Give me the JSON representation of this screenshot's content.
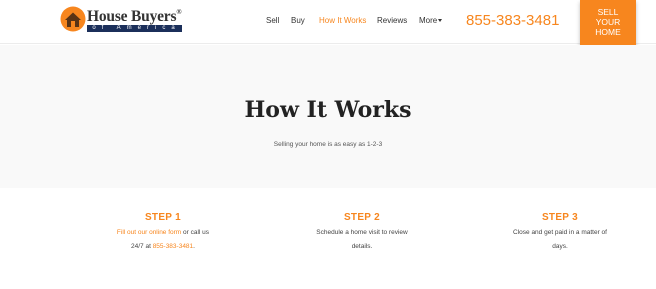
{
  "logo": {
    "title": "House Buyers",
    "reg": "®",
    "tagline": "of America"
  },
  "nav": {
    "items": [
      "Sell",
      "Buy",
      "How It Works",
      "Reviews",
      "More"
    ],
    "active_index": 2
  },
  "phone": "855-383-3481",
  "sell_button": {
    "line1": "SELL",
    "line2": "YOUR",
    "line3": "HOME"
  },
  "hero": {
    "title": "How It Works",
    "subtitle": "Selling your home is as easy as 1-2-3"
  },
  "steps": [
    {
      "title": "STEP 1",
      "link_text": "Fill out our online form",
      "text_a": " or call us",
      "text_b": "24/7 at ",
      "phone": "855-383-3481",
      "text_c": "."
    },
    {
      "title": "STEP 2",
      "line1": "Schedule a home visit to review",
      "line2": "details."
    },
    {
      "title": "STEP 3",
      "line1": "Close and get paid in a matter of",
      "line2": "days."
    }
  ],
  "colors": {
    "accent": "#f7861e",
    "logo_bar": "#1b2f5a",
    "hero_bg": "#f9f9f9"
  },
  "icons": {
    "logo": "house-icon",
    "more": "caret-down-icon"
  }
}
